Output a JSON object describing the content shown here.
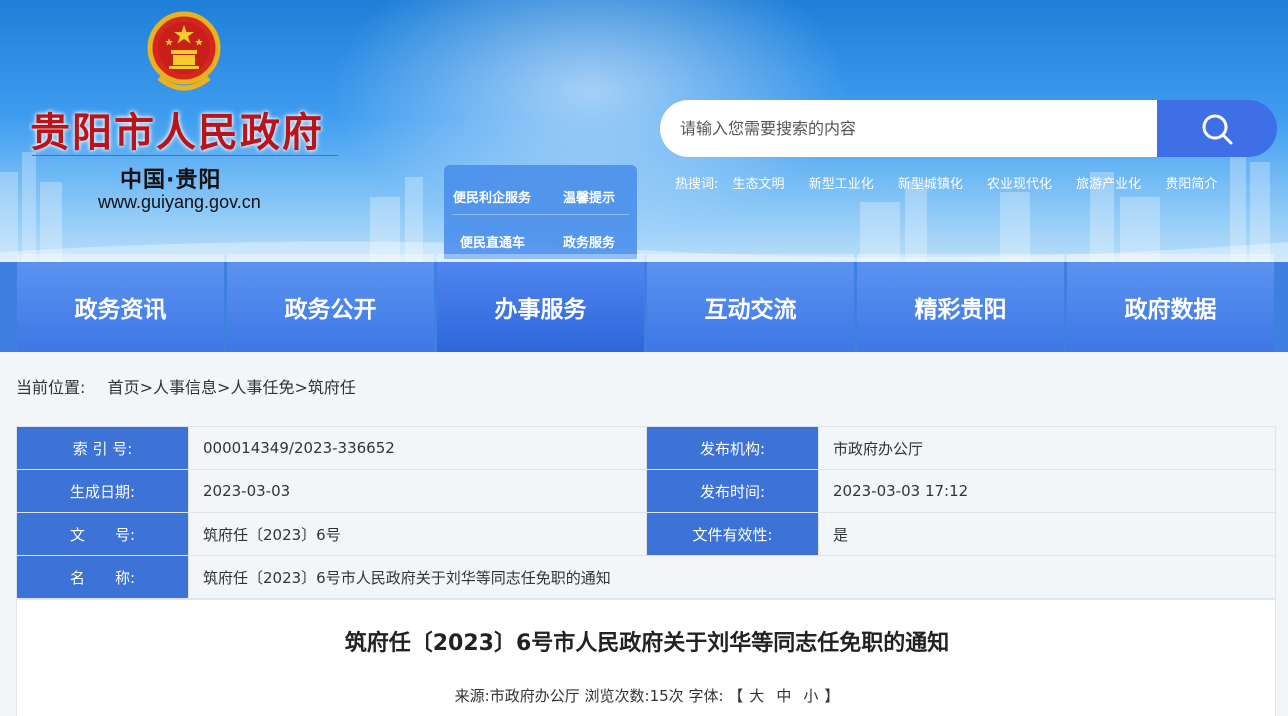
{
  "header": {
    "site_title": "贵阳市人民政府",
    "site_subtitle": "中国·贵阳",
    "site_url": "www.guiyang.gov.cn",
    "emblem_icon": "national-emblem-icon",
    "quick_links": [
      "便民利企服务",
      "温馨提示",
      "便民直通车",
      "政务服务"
    ],
    "search": {
      "placeholder": "请输入您需要搜索的内容",
      "button_icon": "search-icon"
    },
    "hot_label": "热搜词:",
    "hot_words": [
      "生态文明",
      "新型工业化",
      "新型城镇化",
      "农业现代化",
      "旅游产业化",
      "贵阳简介"
    ]
  },
  "nav": {
    "items": [
      "政务资讯",
      "政务公开",
      "办事服务",
      "互动交流",
      "精彩贵阳",
      "政府数据"
    ],
    "active_index": 2
  },
  "breadcrumb": {
    "label": "当前位置:",
    "items": [
      "首页",
      "人事信息",
      "人事任免",
      "筑府任"
    ],
    "separator": ">"
  },
  "info_table": {
    "rows": [
      {
        "l1": "索 引 号:",
        "v1": "000014349/2023-336652",
        "l2": "发布机构:",
        "v2": "市政府办公厅"
      },
      {
        "l1": "生成日期:",
        "v1": "2023-03-03",
        "l2": "发布时间:",
        "v2": "2023-03-03 17:12"
      },
      {
        "l1": "文　　号:",
        "v1": "筑府任〔2023〕6号",
        "l2": "文件有效性:",
        "v2": "是"
      }
    ],
    "name_label": "名　　称:",
    "name_value": "筑府任〔2023〕6号市人民政府关于刘华等同志任免职的通知"
  },
  "article": {
    "title": "筑府任〔2023〕6号市人民政府关于刘华等同志任免职的通知",
    "meta_source_label": "来源:",
    "meta_source": "市政府办公厅",
    "meta_views_label": "浏览次数:",
    "meta_views": "15次",
    "meta_font_label": "字体:",
    "font_open": "【",
    "font_sizes": [
      "大",
      "中",
      "小"
    ],
    "font_close": "】"
  },
  "colors": {
    "brand_red": "#b8141b",
    "nav_blue": "#3e77e6",
    "label_blue": "#3d72d6",
    "search_button": "#3f6fe6"
  }
}
